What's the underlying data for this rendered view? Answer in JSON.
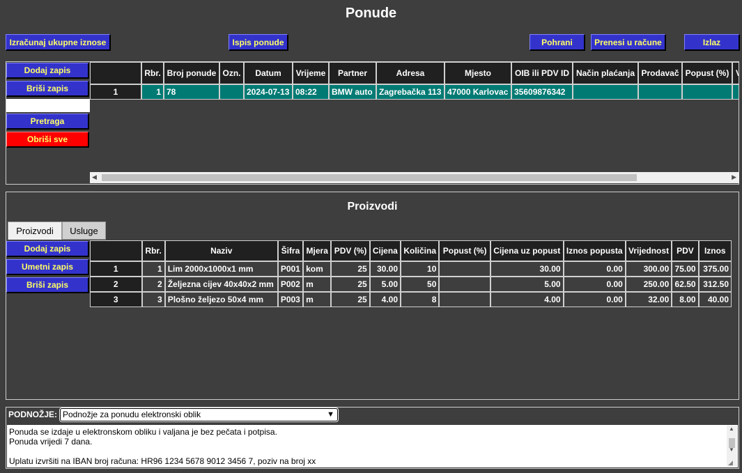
{
  "title": "Ponude",
  "toolbar": {
    "calc": "Izračunaj ukupne iznose",
    "print": "Ispis ponude",
    "save": "Pohrani",
    "transfer": "Prenesi u račune",
    "exit": "Izlaz"
  },
  "offers": {
    "side": {
      "add": "Dodaj zapis",
      "delete": "Briši zapis",
      "search_value": "",
      "search": "Pretraga",
      "clear": "Obriši sve"
    },
    "columns": [
      "",
      "Rbr.",
      "Broj ponude",
      "Ozn.",
      "Datum",
      "Vrijeme",
      "Partner",
      "Adresa",
      "Mjesto",
      "OIB ili PDV ID",
      "Način plaćanja",
      "Prodavač",
      "Popust (%)",
      "V"
    ],
    "rows": [
      [
        "1",
        "1",
        "78",
        "",
        "2024-07-13",
        "08:22",
        "BMW auto",
        "Zagrebačka 113",
        "47000 Karlovac",
        "35609876342",
        "",
        "",
        "",
        ""
      ]
    ]
  },
  "products": {
    "title": "Proizvodi",
    "tabs": [
      "Proizvodi",
      "Usluge"
    ],
    "side": {
      "add": "Dodaj zapis",
      "insert": "Umetni zapis",
      "delete": "Briši zapis"
    },
    "columns": [
      "",
      "Rbr.",
      "Naziv",
      "Šifra",
      "Mjera",
      "PDV (%)",
      "Cijena",
      "Količina",
      "Popust (%)",
      "Cijena uz popust",
      "Iznos popusta",
      "Vrijednost",
      "PDV",
      "Iznos"
    ],
    "rows": [
      [
        "1",
        "1",
        "Lim 2000x1000x1 mm",
        "P001",
        "kom",
        "25",
        "30.00",
        "10",
        "",
        "30.00",
        "0.00",
        "300.00",
        "75.00",
        "375.00"
      ],
      [
        "2",
        "2",
        "Željezna cijev 40x40x2 mm",
        "P002",
        "m",
        "25",
        "5.00",
        "50",
        "",
        "5.00",
        "0.00",
        "250.00",
        "62.50",
        "312.50"
      ],
      [
        "3",
        "3",
        "Plošno željezo 50x4 mm",
        "P003",
        "m",
        "25",
        "4.00",
        "8",
        "",
        "4.00",
        "0.00",
        "32.00",
        "8.00",
        "40.00"
      ]
    ]
  },
  "footer": {
    "label": "PODNOŽJE:",
    "selected": "Podnožje za ponudu elektronski oblik",
    "text": "Ponuda se izdaje u elektronskom obliku i valjana je bez pečata i potpisa.\nPonuda vrijedi 7 dana.\n\nUplatu izvršiti na IBAN broj računa: HR96 1234 5678 9012 3456 7, poziv na broj xx"
  }
}
